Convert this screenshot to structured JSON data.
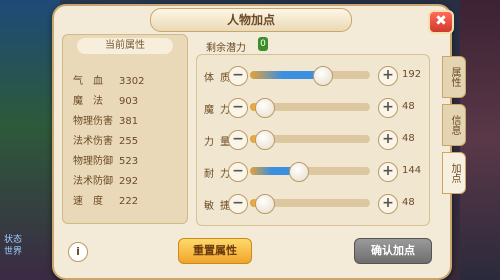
{
  "window": {
    "title": "人物加点",
    "close_glyph": "✖"
  },
  "bg": {
    "line1": "状态",
    "line2": "世界"
  },
  "left_panel": {
    "header": "当前属性",
    "attributes": [
      {
        "label": "气　血",
        "value": "3302"
      },
      {
        "label": "魔　法",
        "value": "903"
      },
      {
        "label": "物理伤害",
        "value": "381"
      },
      {
        "label": "法术伤害",
        "value": "255"
      },
      {
        "label": "物理防御",
        "value": "523"
      },
      {
        "label": "法术防御",
        "value": "292"
      },
      {
        "label": "速　度",
        "value": "222"
      }
    ],
    "info_glyph": "i"
  },
  "potential": {
    "label": "剩余潜力",
    "value": "0"
  },
  "stats": [
    {
      "label": "体质",
      "value": "192",
      "level": 0.6,
      "color": "blue"
    },
    {
      "label": "魔力",
      "value": "48",
      "level": 0.0,
      "color": "orange"
    },
    {
      "label": "力量",
      "value": "48",
      "level": 0.0,
      "color": "orange"
    },
    {
      "label": "耐力",
      "value": "144",
      "level": 0.4,
      "color": "blue"
    },
    {
      "label": "敏捷",
      "value": "48",
      "level": 0.0,
      "color": "orange"
    }
  ],
  "tabs": [
    {
      "label": "属性",
      "active": false
    },
    {
      "label": "信息",
      "active": false
    },
    {
      "label": "加点",
      "active": true
    }
  ],
  "buttons": {
    "minus": "−",
    "plus": "+",
    "reset": "重置属性",
    "confirm": "确认加点"
  }
}
